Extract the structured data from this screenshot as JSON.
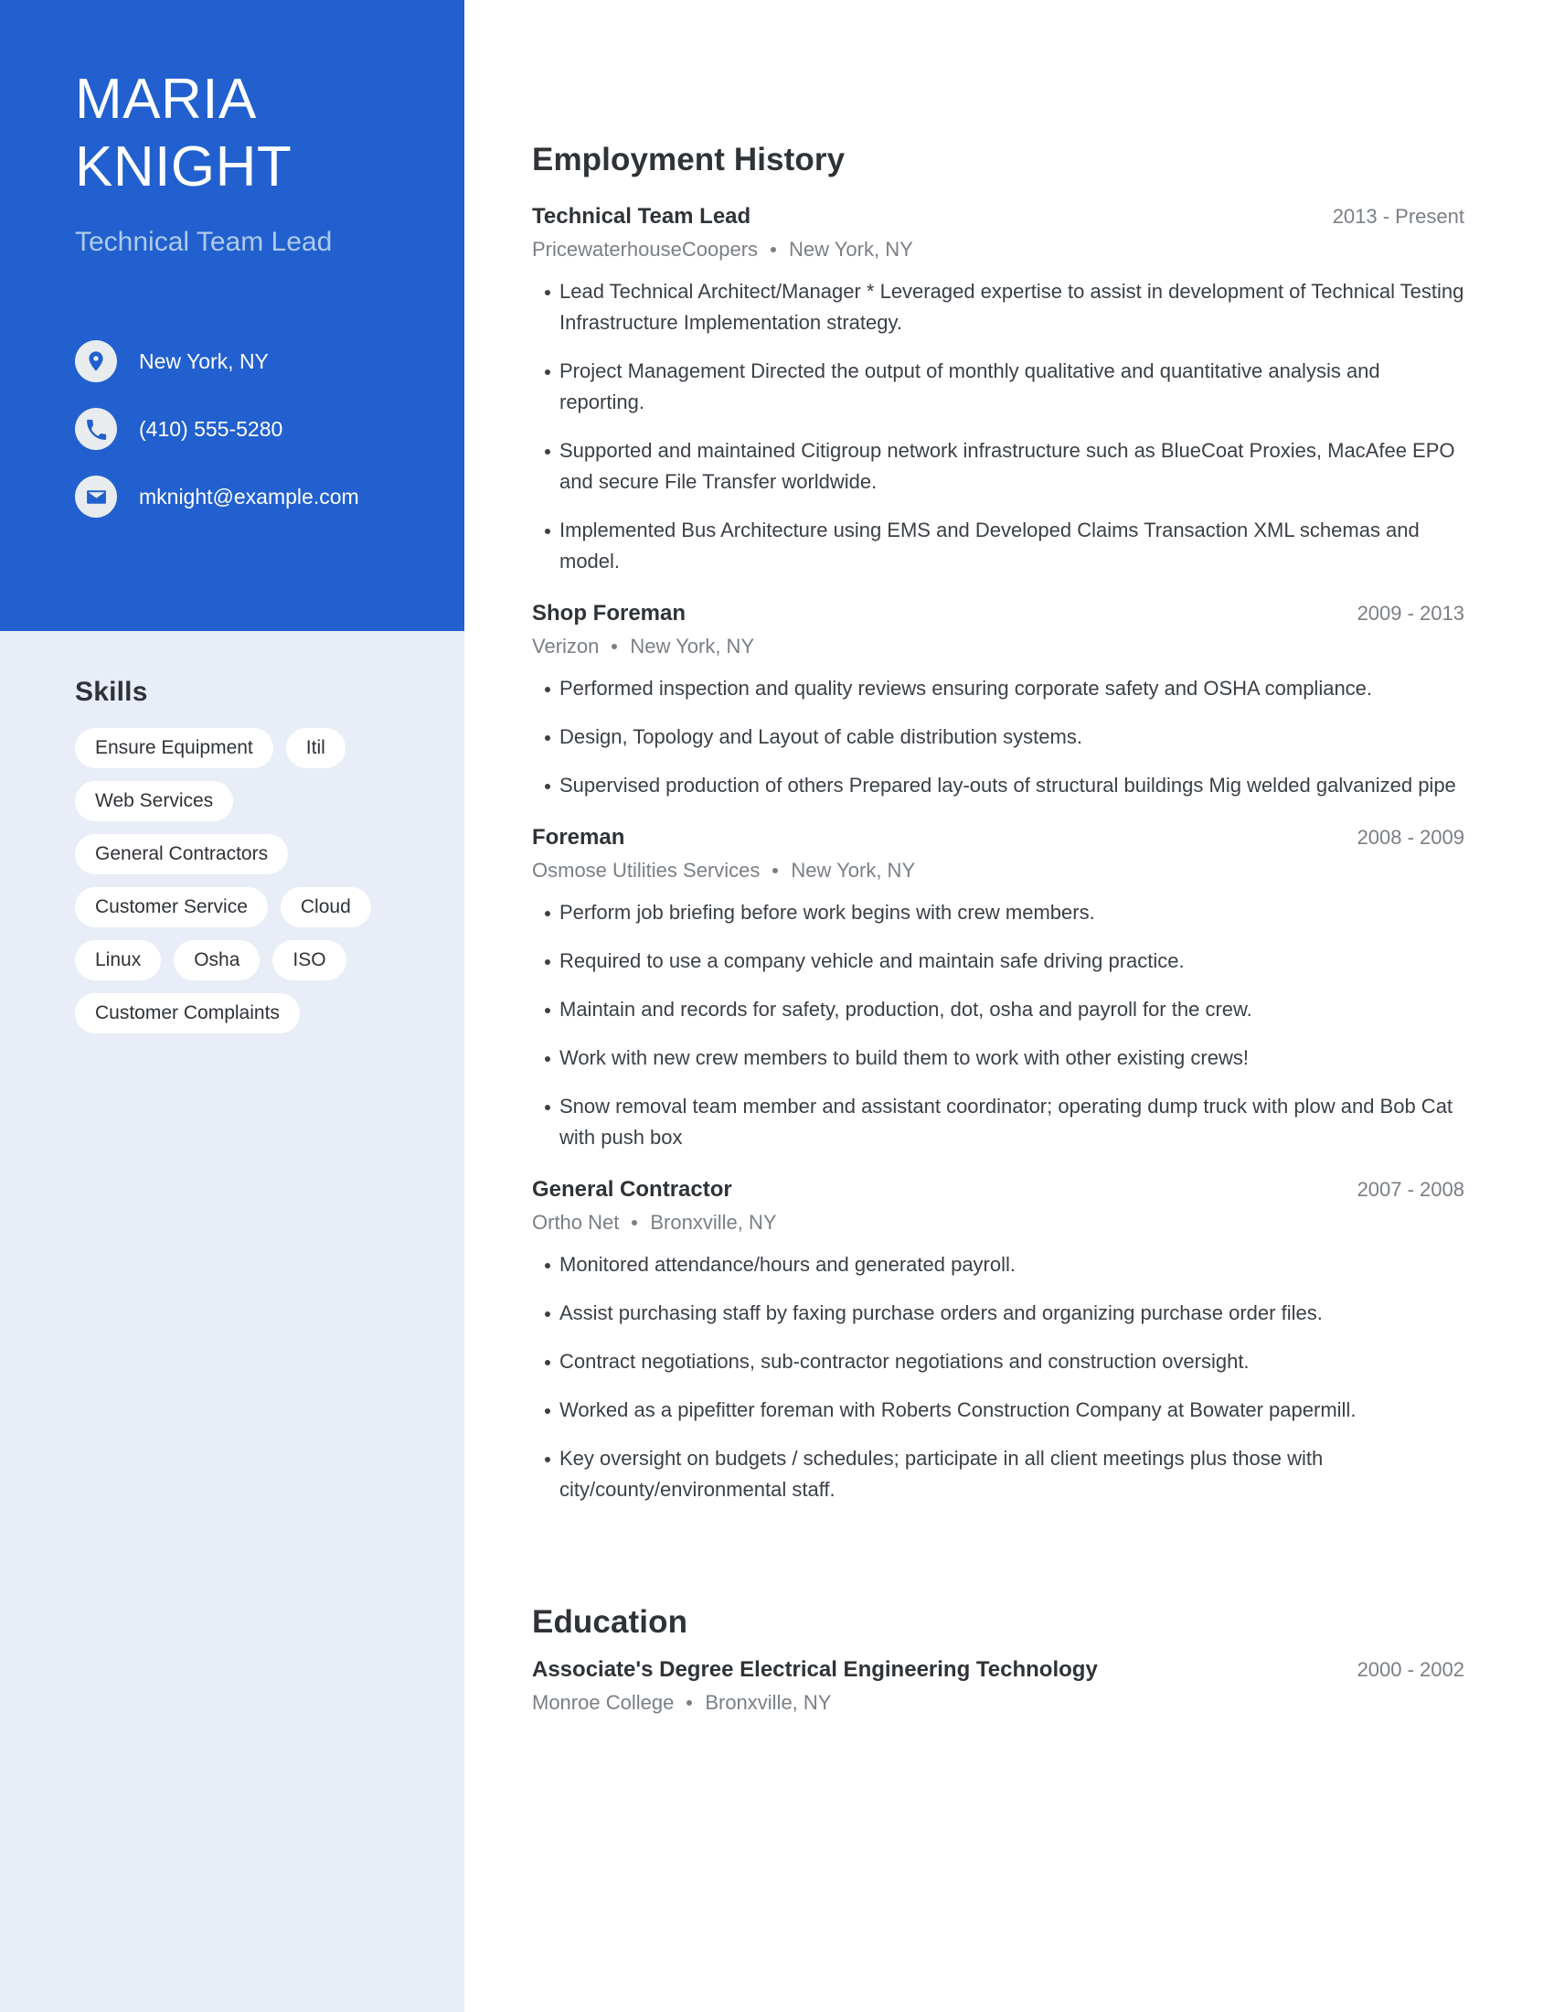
{
  "theme": {
    "accent": "#2160ce",
    "sidebar_bg": "#e8edf7",
    "chip_bg": "#ffffff",
    "title_muted": "#aecaee",
    "text_dark": "#2f3337",
    "text_muted": "#7a7f86"
  },
  "header": {
    "first_name": "MARIA",
    "last_name": "KNIGHT",
    "job_title": "Technical Team Lead"
  },
  "contact": {
    "items": [
      {
        "icon": "location-pin-icon",
        "value": "New York, NY"
      },
      {
        "icon": "phone-icon",
        "value": "(410) 555-5280"
      },
      {
        "icon": "envelope-icon",
        "value": "mknight@example.com"
      }
    ]
  },
  "skills": {
    "heading": "Skills",
    "items": [
      "Ensure Equipment",
      "Itil",
      "Web Services",
      "General Contractors",
      "Customer Service",
      "Cloud",
      "Linux",
      "Osha",
      "ISO",
      "Customer Complaints"
    ]
  },
  "employment": {
    "heading": "Employment History",
    "separator": "•",
    "entries": [
      {
        "title": "Technical Team Lead",
        "date": "2013 - Present",
        "company": "PricewaterhouseCoopers",
        "location": "New York, NY",
        "bullets": [
          "Lead Technical Architect/Manager * Leveraged expertise to assist in development of Technical Testing Infrastructure Implementation strategy.",
          "Project Management Directed the output of monthly qualitative and quantitative analysis and reporting.",
          "Supported and maintained Citigroup network infrastructure such as BlueCoat Proxies, MacAfee EPO and secure File Transfer worldwide.",
          "Implemented Bus Architecture using EMS and Developed Claims Transaction XML schemas and model."
        ]
      },
      {
        "title": "Shop Foreman",
        "date": "2009 - 2013",
        "company": "Verizon",
        "location": "New York, NY",
        "bullets": [
          "Performed inspection and quality reviews ensuring corporate safety and OSHA compliance.",
          "Design, Topology and Layout of cable distribution systems.",
          "Supervised production of others Prepared lay-outs of structural buildings Mig welded galvanized pipe"
        ]
      },
      {
        "title": "Foreman",
        "date": "2008 - 2009",
        "company": "Osmose Utilities Services",
        "location": "New York, NY",
        "bullets": [
          "Perform job briefing before work begins with crew members.",
          "Required to use a company vehicle and maintain safe driving practice.",
          "Maintain and records for safety, production, dot, osha and payroll for the crew.",
          "Work with new crew members to build them to work with other existing crews!",
          "Snow removal team member and assistant coordinator; operating dump truck with plow and Bob Cat with push box"
        ]
      },
      {
        "title": "General Contractor",
        "date": "2007 - 2008",
        "company": "Ortho Net",
        "location": "Bronxville, NY",
        "bullets": [
          "Monitored attendance/hours and generated payroll.",
          "Assist purchasing staff by faxing purchase orders and organizing purchase order files.",
          "Contract negotiations, sub-contractor negotiations and construction oversight.",
          "Worked as a pipefitter foreman with Roberts Construction Company at Bowater papermill.",
          "Key oversight on budgets / schedules; participate in all client meetings plus those with city/county/environmental staff."
        ]
      }
    ]
  },
  "education": {
    "heading": "Education",
    "entries": [
      {
        "title": "Associate's Degree Electrical Engineering Technology",
        "date": "2000 - 2002",
        "school": "Monroe College",
        "location": "Bronxville, NY"
      }
    ]
  }
}
